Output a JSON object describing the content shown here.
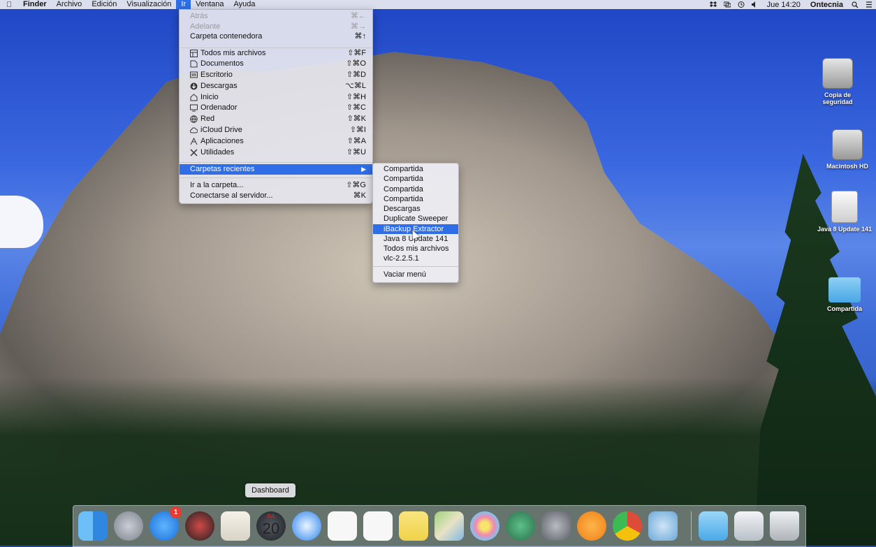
{
  "menubar": {
    "app": "Finder",
    "menus": [
      "Archivo",
      "Edición",
      "Visualización",
      "Ir",
      "Ventana",
      "Ayuda"
    ],
    "active_menu": "Ir",
    "clock": "Jue 14:20",
    "user": "Ontecnia"
  },
  "go_menu": {
    "items": [
      {
        "label": "Atrás",
        "shortcut": "⌘←",
        "disabled": true
      },
      {
        "label": "Adelante",
        "shortcut": "⌘→",
        "disabled": true
      },
      {
        "label": "Carpeta contenedora",
        "shortcut": "⌘↑"
      },
      {
        "label": "Todos mis archivos",
        "shortcut": "⇧⌘F",
        "icon": "all-files-icon"
      },
      {
        "label": "Documentos",
        "shortcut": "⇧⌘O",
        "icon": "documents-icon"
      },
      {
        "label": "Escritorio",
        "shortcut": "⇧⌘D",
        "icon": "desktop-icon"
      },
      {
        "label": "Descargas",
        "shortcut": "⌥⌘L",
        "icon": "downloads-icon"
      },
      {
        "label": "Inicio",
        "shortcut": "⇧⌘H",
        "icon": "home-icon"
      },
      {
        "label": "Ordenador",
        "shortcut": "⇧⌘C",
        "icon": "computer-icon"
      },
      {
        "label": "Red",
        "shortcut": "⇧⌘K",
        "icon": "network-icon"
      },
      {
        "label": "iCloud Drive",
        "shortcut": "⇧⌘I",
        "icon": "cloud-icon"
      },
      {
        "label": "Aplicaciones",
        "shortcut": "⇧⌘A",
        "icon": "applications-icon"
      },
      {
        "label": "Utilidades",
        "shortcut": "⇧⌘U",
        "icon": "utilities-icon"
      },
      {
        "label": "Carpetas recientes",
        "shortcut": "",
        "highlighted": true
      },
      {
        "label": "Ir a la carpeta...",
        "shortcut": "⇧⌘G"
      },
      {
        "label": "Conectarse al servidor...",
        "shortcut": "⌘K"
      }
    ]
  },
  "recent_folders": {
    "items": [
      {
        "label": "Compartida"
      },
      {
        "label": "Compartida"
      },
      {
        "label": "Compartida"
      },
      {
        "label": "Compartida"
      },
      {
        "label": "Descargas"
      },
      {
        "label": "Duplicate Sweeper"
      },
      {
        "label": "iBackup Extractor",
        "highlighted": true
      },
      {
        "label": "Java 8 Update 141"
      },
      {
        "label": "Todos mis archivos"
      },
      {
        "label": "vlc-2.2.5.1"
      }
    ],
    "clear": "Vaciar menú"
  },
  "desktop": {
    "icons": [
      {
        "label": "Copia de seguridad",
        "type": "hard-drive-icon"
      },
      {
        "label": "Macintosh HD",
        "type": "hard-drive-icon"
      },
      {
        "label": "Java 8 Update 141",
        "type": "removable-disk-icon"
      },
      {
        "label": "Compartida",
        "type": "folder-icon"
      }
    ]
  },
  "dock": {
    "tooltip": "Dashboard",
    "badge_count": "1",
    "calendar_month": "JUL",
    "calendar_day": "20",
    "items": [
      "finder-icon",
      "launchpad-icon",
      "app-store-icon",
      "spider-app-icon",
      "textedit-icon",
      "dashboard-icon",
      "safari-icon",
      "calendar-icon",
      "reminders-icon",
      "notes-icon",
      "maps-icon",
      "photos-icon",
      "time-machine-icon",
      "system-preferences-icon",
      "ibooks-icon",
      "chrome-icon",
      "webcam-app-icon",
      "documents-folder-icon",
      "downloads-stack-icon",
      "trash-icon"
    ],
    "colors": [
      "#4aa3f0",
      "#9aa0ab",
      "#2a8cf5",
      "#c23b3b",
      "#e8e4da",
      "#3b3f46",
      "#2c87f0",
      "#f2f2f2",
      "#f5f5f5",
      "#f6e07a",
      "#8bc56b",
      "#f0a0c0",
      "#3a9a6a",
      "#8e8e93",
      "#f39a2b",
      "#dd4b39",
      "#6aa8d8",
      "#5ab5e8",
      "#b0b8c2",
      "#c9ced4"
    ]
  }
}
